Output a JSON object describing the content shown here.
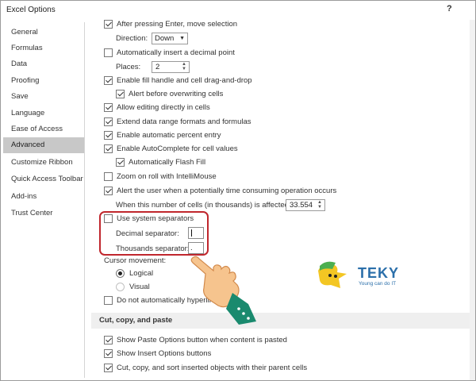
{
  "window": {
    "title": "Excel Options",
    "help": "?"
  },
  "sidebar": {
    "items": [
      {
        "label": "General"
      },
      {
        "label": "Formulas"
      },
      {
        "label": "Data"
      },
      {
        "label": "Proofing"
      },
      {
        "label": "Save"
      },
      {
        "label": "Language"
      },
      {
        "label": "Ease of Access"
      },
      {
        "label": "Advanced"
      },
      {
        "label": "Customize Ribbon"
      },
      {
        "label": "Quick Access Toolbar"
      },
      {
        "label": "Add-ins"
      },
      {
        "label": "Trust Center"
      }
    ],
    "active": "Advanced"
  },
  "options": {
    "after_enter": {
      "label": "After pressing Enter, move selection",
      "checked": true
    },
    "direction": {
      "label": "Direction:",
      "value": "Down"
    },
    "decimal_point": {
      "label": "Automatically insert a decimal point",
      "checked": false
    },
    "places": {
      "label": "Places:",
      "value": "2"
    },
    "fill_handle": {
      "label": "Enable fill handle and cell drag-and-drop",
      "checked": true
    },
    "alert_overwrite": {
      "label": "Alert before overwriting cells",
      "checked": true
    },
    "edit_directly": {
      "label": "Allow editing directly in cells",
      "checked": true
    },
    "extend_range": {
      "label": "Extend data range formats and formulas",
      "checked": true
    },
    "percent_entry": {
      "label": "Enable automatic percent entry",
      "checked": true
    },
    "autocomplete": {
      "label": "Enable AutoComplete for cell values",
      "checked": true
    },
    "flash_fill": {
      "label": "Automatically Flash Fill",
      "checked": true
    },
    "zoom_roll": {
      "label": "Zoom on roll with IntelliMouse",
      "checked": false
    },
    "alert_time": {
      "label": "Alert the user when a potentially time consuming operation occurs",
      "checked": true
    },
    "cells_affected": {
      "label": "When this number of cells (in thousands) is affected:",
      "value": "33.554"
    },
    "system_separators": {
      "label": "Use system separators",
      "checked": false
    },
    "decimal_separator": {
      "label": "Decimal separator:",
      "value": ""
    },
    "thousands_separator": {
      "label": "Thousands separator:",
      "value": "."
    },
    "cursor_movement": {
      "label": "Cursor movement:"
    },
    "logical": {
      "label": "Logical",
      "selected": true
    },
    "visual": {
      "label": "Visual",
      "selected": false
    },
    "no_hyperlink": {
      "label": "Do not automatically hyperlink",
      "checked": false
    }
  },
  "cut_copy": {
    "header": "Cut, copy, and paste",
    "paste_options": {
      "label": "Show Paste Options button when content is pasted",
      "checked": true
    },
    "insert_options": {
      "label": "Show Insert Options buttons",
      "checked": true
    },
    "cut_sort": {
      "label": "Cut, copy, and sort inserted objects with their parent cells",
      "checked": true
    }
  },
  "logo": {
    "brand": "TEKY",
    "tagline": "Young can do IT"
  },
  "colors": {
    "highlight": "#c0272d",
    "active_nav": "#c8c8c8",
    "logo_blue": "#2b6faa",
    "logo_green": "#4caf50",
    "logo_yellow": "#f3c623",
    "hand_skin": "#f6c48e",
    "cuff": "#1a8a6e"
  }
}
